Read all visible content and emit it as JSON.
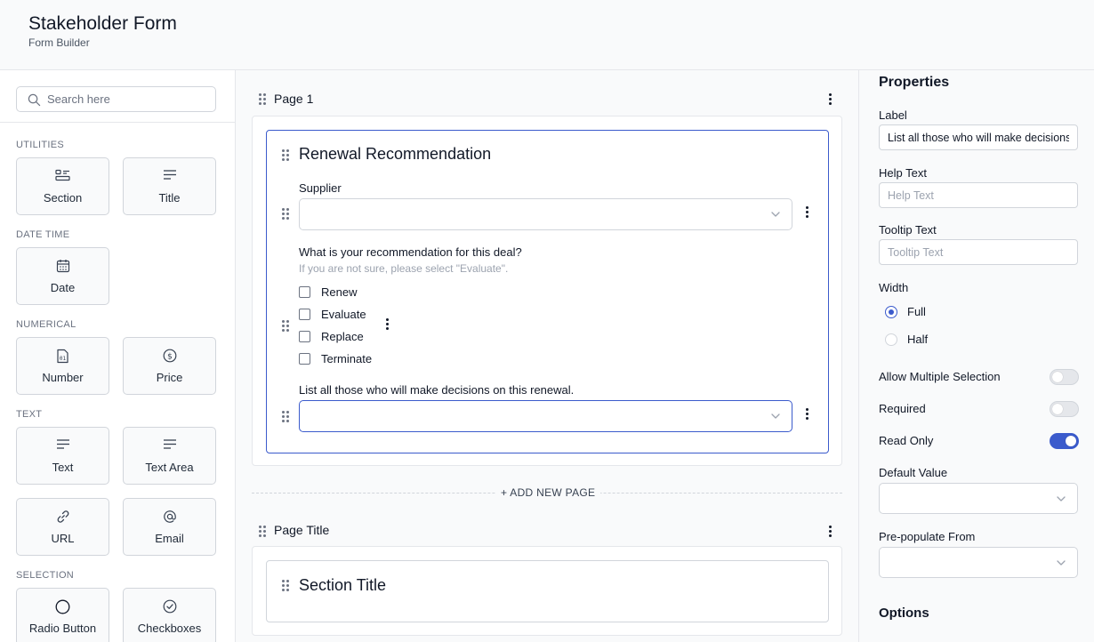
{
  "header": {
    "title": "Stakeholder Form",
    "subtitle": "Form Builder"
  },
  "sidebar": {
    "search_placeholder": "Search here",
    "groups": [
      {
        "label": "UTILITIES",
        "items": [
          {
            "label": "Section",
            "icon": "section-icon"
          },
          {
            "label": "Title",
            "icon": "title-icon"
          }
        ]
      },
      {
        "label": "DATE TIME",
        "items": [
          {
            "label": "Date",
            "icon": "calendar-icon"
          }
        ]
      },
      {
        "label": "NUMERICAL",
        "items": [
          {
            "label": "Number",
            "icon": "number-icon"
          },
          {
            "label": "Price",
            "icon": "dollar-icon"
          }
        ]
      },
      {
        "label": "TEXT",
        "items": [
          {
            "label": "Text",
            "icon": "text-icon"
          },
          {
            "label": "Text Area",
            "icon": "text-area-icon"
          },
          {
            "label": "URL",
            "icon": "link-icon"
          },
          {
            "label": "Email",
            "icon": "at-icon"
          }
        ]
      },
      {
        "label": "SELECTION",
        "items": [
          {
            "label": "Radio Button",
            "icon": "radio-icon"
          },
          {
            "label": "Checkboxes",
            "icon": "check-circle-icon"
          }
        ]
      }
    ]
  },
  "canvas": {
    "pages": [
      {
        "title": "Page 1",
        "section": {
          "title": "Renewal Recommendation",
          "fields": {
            "supplier": {
              "label": "Supplier",
              "value": ""
            },
            "recommendation": {
              "label": "What is your recommendation for this deal?",
              "help": "If you are not sure, please select \"Evaluate\".",
              "options": [
                "Renew",
                "Evaluate",
                "Replace",
                "Terminate"
              ]
            },
            "decision_makers": {
              "label": "List all those who will make decisions on this renewal.",
              "value": ""
            }
          }
        }
      },
      {
        "title": "Page Title",
        "section": {
          "title": "Section Title"
        }
      }
    ],
    "add_page_label": "+ ADD NEW PAGE"
  },
  "properties": {
    "title": "Properties",
    "label_field": {
      "label": "Label",
      "value": "List all those who will make decisions on this renewal."
    },
    "help_text": {
      "label": "Help Text",
      "placeholder": "Help Text"
    },
    "tooltip_text": {
      "label": "Tooltip Text",
      "placeholder": "Tooltip Text"
    },
    "width": {
      "label": "Width",
      "options": [
        "Full",
        "Half"
      ],
      "selected": "Full"
    },
    "toggles": [
      {
        "label": "Allow Multiple Selection",
        "on": false
      },
      {
        "label": "Required",
        "on": false
      },
      {
        "label": "Read Only",
        "on": true
      }
    ],
    "default_value": {
      "label": "Default Value",
      "value": ""
    },
    "prepopulate": {
      "label": "Pre-populate From",
      "value": ""
    },
    "options_title": "Options"
  },
  "colors": {
    "accent": "#3b5bcc",
    "border": "#d1d5db",
    "text": "#111827"
  }
}
